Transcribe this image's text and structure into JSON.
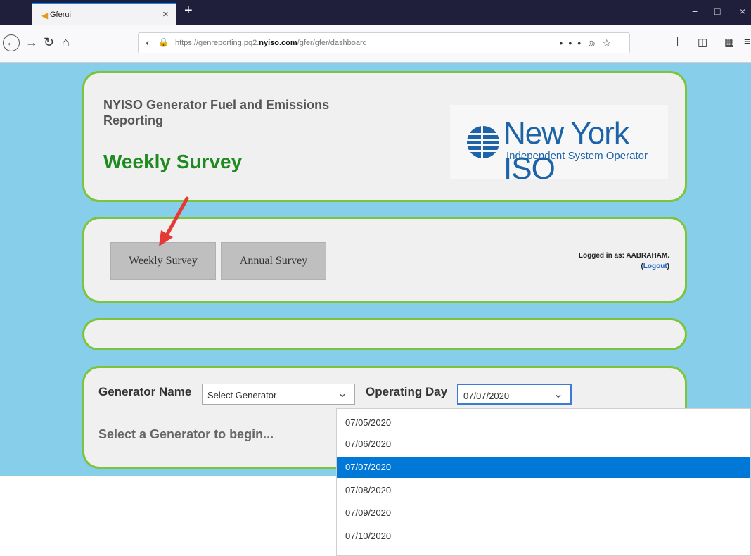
{
  "browser": {
    "tab_title": "Gferui",
    "url_prefix": "https://genreporting.pq2.",
    "url_domain": "nyiso.com",
    "url_path": "/gfer/gfer/dashboard",
    "url_more_icon": "•••",
    "url_pocket_icon": "☺",
    "url_star_icon": "☆"
  },
  "header": {
    "app_title": "NYISO Generator Fuel and Emissions Reporting",
    "page_title": "Weekly Survey",
    "logo_name": "New York ISO",
    "logo_subtitle": "Independent System Operator"
  },
  "nav": {
    "weekly_button": "Weekly Survey",
    "annual_button": "Annual Survey",
    "logged_in_label": "Logged in as: AABRAHAM.",
    "logout_open": "(",
    "logout_label": "Logout",
    "logout_close": ")"
  },
  "form": {
    "generator_label": "Generator Name",
    "generator_value": "Select Generator",
    "operating_day_label": "Operating Day",
    "operating_day_value": "07/07/2020",
    "prompt": "Select a Generator to begin..."
  },
  "dropdown": {
    "options": [
      "07/05/2020",
      "07/06/2020",
      "07/07/2020",
      "07/08/2020",
      "07/09/2020",
      "07/10/2020"
    ],
    "selected_index": 2
  },
  "colors": {
    "page_bg": "#87ceeb",
    "card_border": "#7cc43b",
    "title_green": "#1f8a1f",
    "selection_blue": "#0078d7",
    "arrow_red": "#e53935"
  }
}
